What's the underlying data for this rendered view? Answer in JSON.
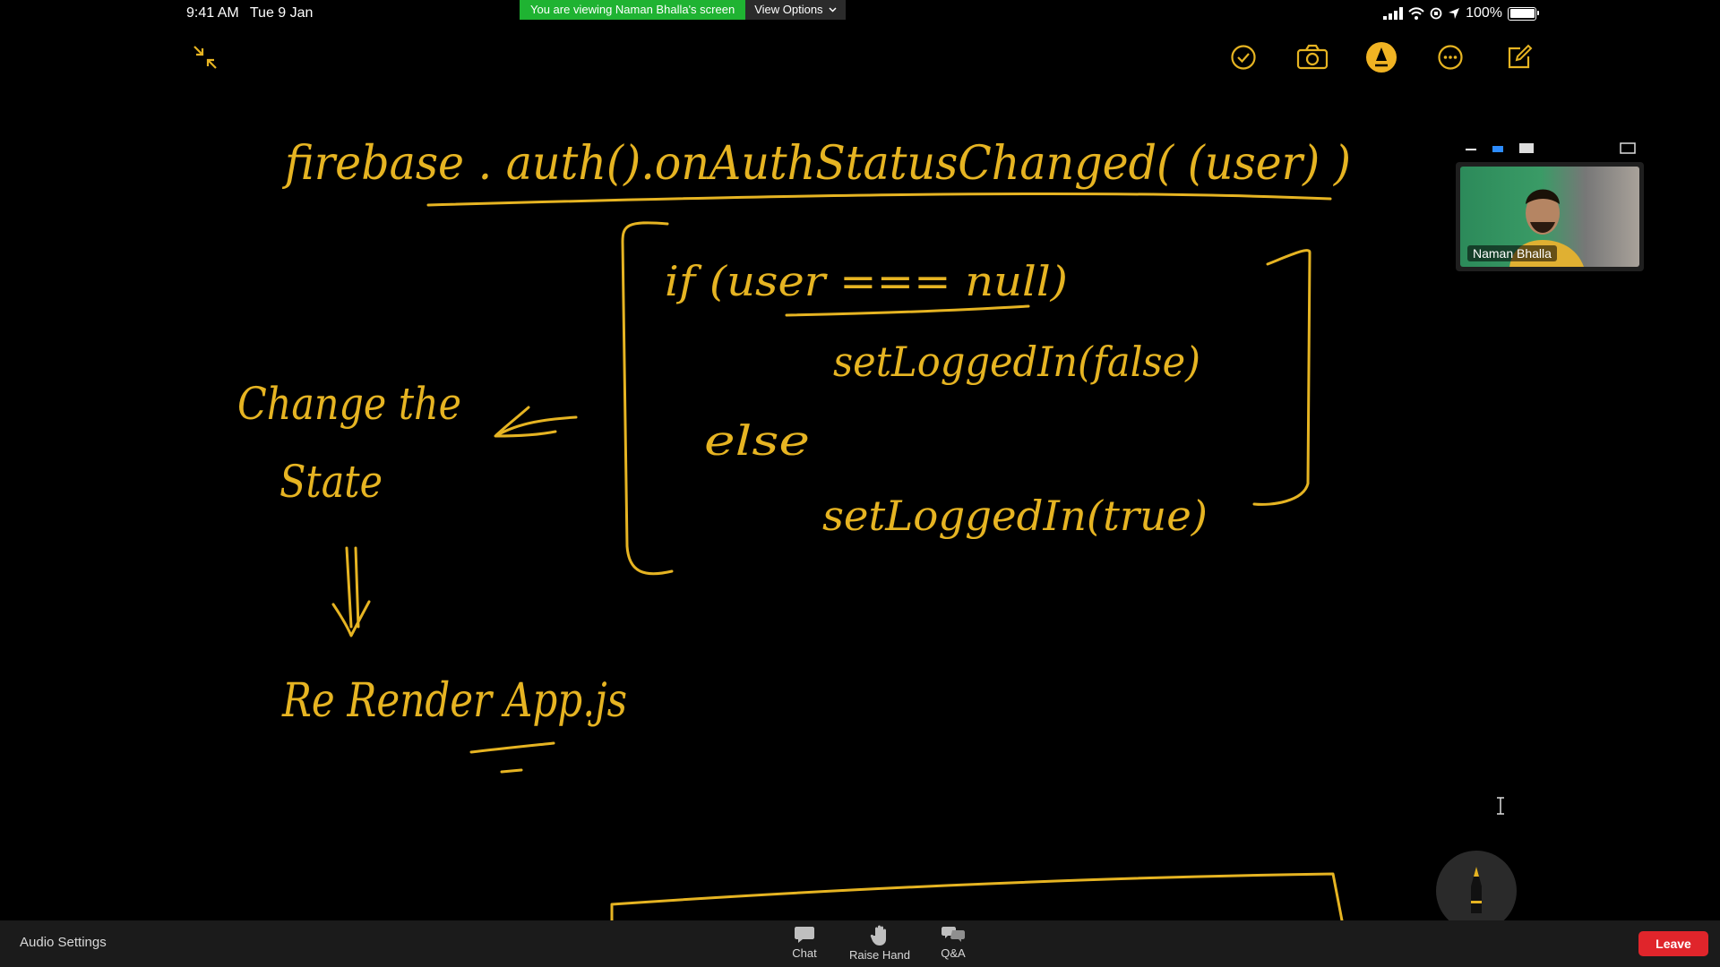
{
  "status_bar": {
    "time": "9:41 AM",
    "date": "Tue 9 Jan",
    "battery": "100%"
  },
  "share_banner": {
    "message": "You are viewing Naman Bhalla's screen",
    "view_options_label": "View Options"
  },
  "toolbar": {
    "icons": [
      "checkmark-circle-icon",
      "camera-icon",
      "markup-pen-icon",
      "more-icon",
      "compose-icon"
    ],
    "active_color": "#f0b323"
  },
  "whiteboard": {
    "ink_color": "#e6b422",
    "line1": "firebase . auth().onAuthStatusChanged( (user) )",
    "if_line": "if (user === null)",
    "set_false": "setLoggedIn(false)",
    "else_label": "else",
    "set_true": "setLoggedIn(true)",
    "change_state_1": "Change the",
    "change_state_2": "State",
    "rerender": "Re Render App.js"
  },
  "participant": {
    "name": "Naman Bhalla"
  },
  "bottom_bar": {
    "audio_settings": "Audio Settings",
    "chat": "Chat",
    "raise_hand": "Raise Hand",
    "qa": "Q&A",
    "leave": "Leave",
    "leave_color": "#e0252b"
  }
}
